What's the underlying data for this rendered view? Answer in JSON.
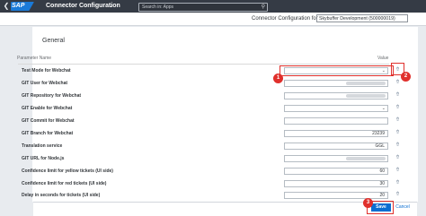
{
  "shell": {
    "logo": "SAP",
    "title": "Connector Configuration",
    "search_placeholder": "Search in: Apps"
  },
  "context": {
    "label": "Connector Configuration for",
    "value": "Skybuffer Development (500000019)"
  },
  "section": {
    "title": "General",
    "col_param": "Parameter Name",
    "col_value": "Value"
  },
  "rows": [
    {
      "label": "Test Mode for Webchat",
      "value": "",
      "type": "select"
    },
    {
      "label": "GIT User for Webchat",
      "value": "",
      "type": "masked"
    },
    {
      "label": "GIT Repository for Webchat",
      "value": "",
      "type": "masked"
    },
    {
      "label": "GIT Enable for Webchat",
      "value": "",
      "type": "select"
    },
    {
      "label": "GIT Commit for Webchat",
      "value": "",
      "type": "text"
    },
    {
      "label": "GIT Branch for Webchat",
      "value": "23239",
      "type": "text"
    },
    {
      "label": "Translation service",
      "value": "GGL",
      "type": "text"
    },
    {
      "label": "GIT URL for Node.js",
      "value": "",
      "type": "masked"
    },
    {
      "label": "Confidence limit for yellow tickets (UI side)",
      "value": "60",
      "type": "text"
    },
    {
      "label": "Confidence limit for red tickets (UI side)",
      "value": "30",
      "type": "text"
    },
    {
      "label": "Delay in seconds for tickets (UI side)",
      "value": "20",
      "type": "text"
    }
  ],
  "callouts": [
    "1",
    "2",
    "3"
  ],
  "footer": {
    "save": "Save",
    "cancel": "Cancel"
  }
}
